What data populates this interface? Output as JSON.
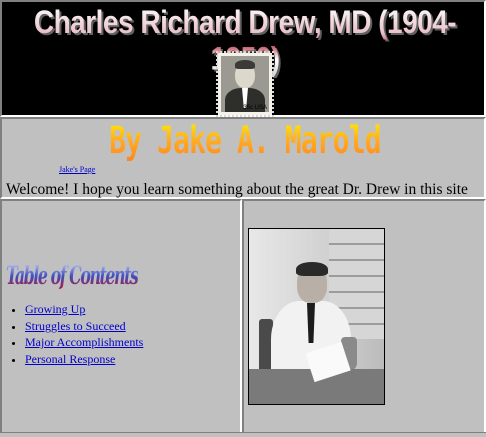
{
  "banner": {
    "title": "Charles Richard Drew, MD (1904-1950)",
    "stamp_value": "35c USA"
  },
  "header": {
    "author": "By Jake A. Marold",
    "jake_link": "Jake's Page",
    "welcome": "Welcome! I hope you learn something about the great Dr. Drew in this site"
  },
  "toc": {
    "title": "Table of Contents",
    "items": [
      {
        "label": "Growing Up"
      },
      {
        "label": "Struggles to Succeed"
      },
      {
        "label": "Major Accomplishments"
      },
      {
        "label": "Personal Response"
      }
    ]
  },
  "colors": {
    "banner_bg": "#000000",
    "page_bg": "#c0c0c0",
    "link": "#0000cc"
  }
}
